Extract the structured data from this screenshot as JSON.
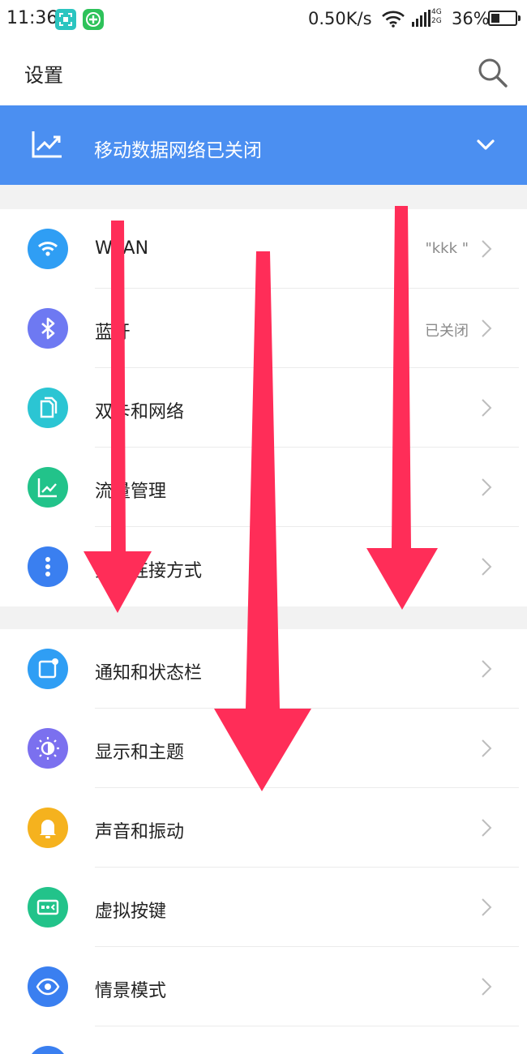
{
  "status_bar": {
    "time": "11:36",
    "speed": "0.50K/s",
    "net_type_top": "4G",
    "net_type_bottom": "2G",
    "battery_pct": "36%",
    "battery_level": 0.36
  },
  "app_bar": {
    "title": "设置"
  },
  "data_banner": {
    "text": "移动数据网络已关闭"
  },
  "sections": [
    {
      "items": [
        {
          "icon": "wifi-icon",
          "label": "WLAN",
          "value": "\"kkk \"",
          "color": "#2f9ef4"
        },
        {
          "icon": "bluetooth-icon",
          "label": "蓝牙",
          "value": "已关闭",
          "color": "#6e79f2"
        },
        {
          "icon": "dual-sim-icon",
          "label": "双卡和网络",
          "value": "",
          "color": "#2bc5d3"
        },
        {
          "icon": "data-usage-icon",
          "label": "流量管理",
          "value": "",
          "color": "#22c38a"
        },
        {
          "icon": "more-vertical-icon",
          "label": "其他连接方式",
          "value": "",
          "color": "#3a7ff0"
        }
      ]
    },
    {
      "items": [
        {
          "icon": "notification-icon",
          "label": "通知和状态栏",
          "value": "",
          "color": "#2f9ef4"
        },
        {
          "icon": "brightness-icon",
          "label": "显示和主题",
          "value": "",
          "color": "#7b70ef"
        },
        {
          "icon": "bell-icon",
          "label": "声音和振动",
          "value": "",
          "color": "#f5b21e"
        },
        {
          "icon": "virtual-keys-icon",
          "label": "虚拟按键",
          "value": "",
          "color": "#22c38a"
        },
        {
          "icon": "eye-icon",
          "label": "情景模式",
          "value": "",
          "color": "#3a7ff0"
        },
        {
          "icon": "generic-icon",
          "label": "",
          "value": "",
          "color": "#3a7ff0"
        }
      ]
    }
  ],
  "colors": {
    "banner": "#4b8ff1",
    "arrow": "#ff2d58"
  }
}
